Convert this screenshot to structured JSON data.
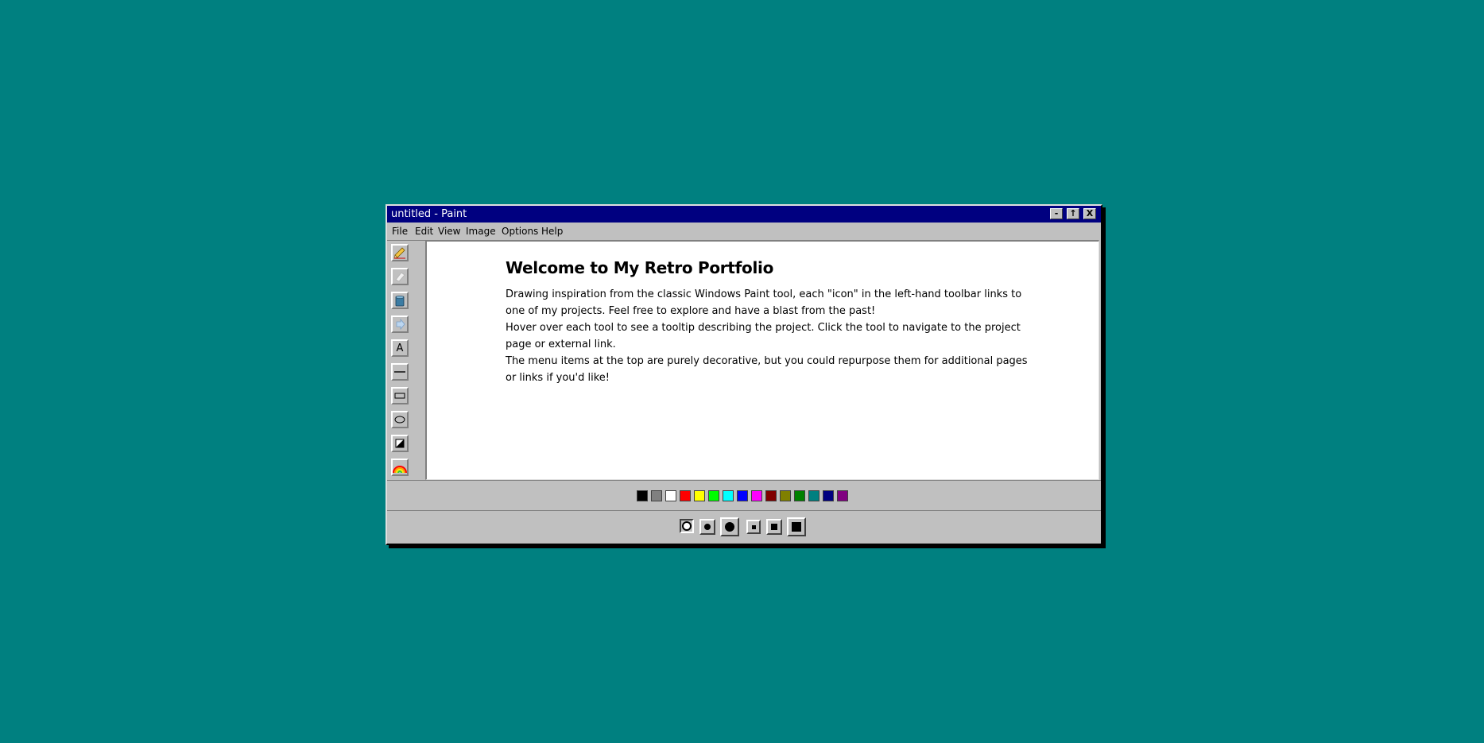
{
  "window": {
    "title": "untitled - Paint",
    "minimize_label": "-",
    "maximize_label": "↑",
    "close_label": "X"
  },
  "menu": [
    "File",
    "Edit",
    "View",
    "Image",
    "Options",
    "Help"
  ],
  "tools": [
    {
      "name": "pencil-icon"
    },
    {
      "name": "eraser-icon"
    },
    {
      "name": "paint-bucket-icon"
    },
    {
      "name": "color-picker-icon"
    },
    {
      "name": "text-tool-icon",
      "label": "A"
    },
    {
      "name": "line-tool-icon"
    },
    {
      "name": "rectangle-tool-icon"
    },
    {
      "name": "ellipse-tool-icon"
    },
    {
      "name": "fill-shape-tool-icon"
    },
    {
      "name": "rainbow-icon"
    }
  ],
  "canvas": {
    "heading": "Welcome to My Retro Portfolio",
    "paragraphs": [
      "Drawing inspiration from the classic Windows Paint tool, each \"icon\" in the left-hand toolbar links to one of my projects. Feel free to explore and have a blast from the past!",
      "Hover over each tool to see a tooltip describing the project. Click the tool to navigate to the project page or external link.",
      "The menu items at the top are purely decorative, but you could repurpose them for additional pages or links if you'd like!"
    ]
  },
  "palette": [
    "#000000",
    "#808080",
    "#ffffff",
    "#ff0000",
    "#ffff00",
    "#00ff00",
    "#00ffff",
    "#0000ff",
    "#ff00ff",
    "#800000",
    "#808000",
    "#008000",
    "#008080",
    "#000080",
    "#800080"
  ],
  "brush_sizes": [
    {
      "shape": "round",
      "size": "small",
      "selected": true
    },
    {
      "shape": "round",
      "size": "medium",
      "selected": false
    },
    {
      "shape": "round",
      "size": "large",
      "selected": false
    },
    {
      "shape": "square",
      "size": "small",
      "selected": false
    },
    {
      "shape": "square",
      "size": "medium",
      "selected": false
    },
    {
      "shape": "square",
      "size": "large",
      "selected": false
    }
  ],
  "colors": {
    "desktop": "#008080",
    "titlebar": "#000080",
    "chrome": "#c0c0c0"
  }
}
